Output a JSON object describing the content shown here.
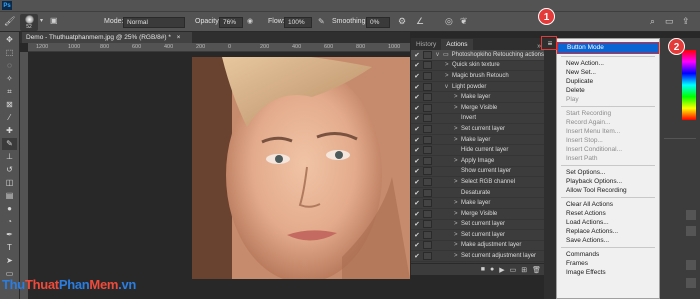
{
  "menubar": {
    "logo": "Ps",
    "items": [
      "File",
      "Edit",
      "Image",
      "Layer",
      "Type",
      "Select",
      "Filter",
      "3D",
      "View",
      "Window",
      "Help"
    ]
  },
  "options": {
    "brush_size": "52",
    "mode_label": "Mode:",
    "mode_value": "Normal",
    "opacity_label": "Opacity:",
    "opacity_value": "76%",
    "flow_label": "Flow:",
    "flow_value": "100%",
    "smoothing_label": "Smoothing:",
    "smoothing_value": "0%"
  },
  "document": {
    "tab_title": "Demo - Thuthuatphanmem.jpg @ 25% (RGB/8#) *",
    "ruler_ticks": [
      "1200",
      "1000",
      "800",
      "600",
      "400",
      "200",
      "0",
      "200",
      "400",
      "600",
      "800",
      "1000"
    ]
  },
  "actions_panel": {
    "tabs": [
      "History",
      "Actions"
    ],
    "rows": [
      {
        "indent": 0,
        "twisty": "v",
        "label": "Photoshopkiho Retouching actions",
        "set": true
      },
      {
        "indent": 1,
        "twisty": ">",
        "label": "Quick skin texture"
      },
      {
        "indent": 1,
        "twisty": ">",
        "label": "Magic brush Retouch"
      },
      {
        "indent": 1,
        "twisty": "v",
        "label": "Light powder"
      },
      {
        "indent": 2,
        "twisty": ">",
        "label": "Make layer"
      },
      {
        "indent": 2,
        "twisty": ">",
        "label": "Merge Visible"
      },
      {
        "indent": 2,
        "twisty": "",
        "label": "Invert"
      },
      {
        "indent": 2,
        "twisty": ">",
        "label": "Set current layer"
      },
      {
        "indent": 2,
        "twisty": ">",
        "label": "Make layer"
      },
      {
        "indent": 2,
        "twisty": "",
        "label": "Hide current layer"
      },
      {
        "indent": 2,
        "twisty": ">",
        "label": "Apply Image"
      },
      {
        "indent": 2,
        "twisty": "",
        "label": "Show current layer"
      },
      {
        "indent": 2,
        "twisty": ">",
        "label": "Select RGB channel"
      },
      {
        "indent": 2,
        "twisty": "",
        "label": "Desaturate"
      },
      {
        "indent": 2,
        "twisty": ">",
        "label": "Make layer"
      },
      {
        "indent": 2,
        "twisty": ">",
        "label": "Merge Visible"
      },
      {
        "indent": 2,
        "twisty": ">",
        "label": "Set current layer"
      },
      {
        "indent": 2,
        "twisty": ">",
        "label": "Set current layer"
      },
      {
        "indent": 2,
        "twisty": ">",
        "label": "Make adjustment layer"
      },
      {
        "indent": 2,
        "twisty": ">",
        "label": "Set current adjustment layer"
      }
    ],
    "bottom_icons": [
      "stop-icon",
      "record-icon",
      "play-icon",
      "new-set-icon",
      "new-action-icon",
      "trash-icon"
    ]
  },
  "panel_menu": {
    "groups": [
      [
        {
          "label": "Button Mode",
          "enabled": true,
          "highlighted": true
        }
      ],
      [
        {
          "label": "New Action...",
          "enabled": true
        },
        {
          "label": "New Set...",
          "enabled": true
        },
        {
          "label": "Duplicate",
          "enabled": true
        },
        {
          "label": "Delete",
          "enabled": true
        },
        {
          "label": "Play",
          "enabled": false
        }
      ],
      [
        {
          "label": "Start Recording",
          "enabled": false
        },
        {
          "label": "Record Again...",
          "enabled": false
        },
        {
          "label": "Insert Menu Item...",
          "enabled": false
        },
        {
          "label": "Insert Stop...",
          "enabled": false
        },
        {
          "label": "Insert Conditional...",
          "enabled": false
        },
        {
          "label": "Insert Path",
          "enabled": false
        }
      ],
      [
        {
          "label": "Set Options...",
          "enabled": true
        },
        {
          "label": "Playback Options...",
          "enabled": true
        },
        {
          "label": "Allow Tool Recording",
          "enabled": true
        }
      ],
      [
        {
          "label": "Clear All Actions",
          "enabled": true
        },
        {
          "label": "Reset Actions",
          "enabled": true
        },
        {
          "label": "Load Actions...",
          "enabled": true
        },
        {
          "label": "Replace Actions...",
          "enabled": true
        },
        {
          "label": "Save Actions...",
          "enabled": true
        }
      ],
      [
        {
          "label": "Commands",
          "enabled": true
        },
        {
          "label": "Frames",
          "enabled": true
        },
        {
          "label": "Image Effects",
          "enabled": true
        }
      ]
    ]
  },
  "annotations": {
    "step1": "1",
    "step2": "2"
  },
  "watermark": {
    "parts": [
      {
        "text": "Thu",
        "color": "#2a7de1"
      },
      {
        "text": "Thuat",
        "color": "#f04a3a"
      },
      {
        "text": "Phan",
        "color": "#2a7de1"
      },
      {
        "text": "Mem",
        "color": "#f04a3a"
      },
      {
        "text": ".vn",
        "color": "#2a7de1"
      }
    ]
  },
  "colors": {
    "menu_highlight": "#0a64d2",
    "annotation_red": "#e53a3a"
  }
}
